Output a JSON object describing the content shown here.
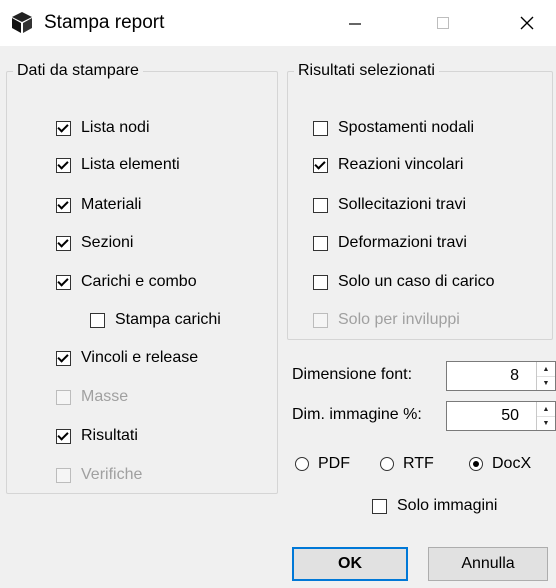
{
  "window": {
    "title": "Stampa report",
    "controls": {
      "minimize": "—",
      "maximize": "☐",
      "close": "✕"
    }
  },
  "print_data_group": {
    "legend": "Dati da stampare",
    "items": [
      {
        "label": "Lista nodi",
        "checked": true,
        "enabled": true
      },
      {
        "label": "Lista elementi",
        "checked": true,
        "enabled": true
      },
      {
        "label": "Materiali",
        "checked": true,
        "enabled": true
      },
      {
        "label": "Sezioni",
        "checked": true,
        "enabled": true
      },
      {
        "label": "Carichi e combo",
        "checked": true,
        "enabled": true
      },
      {
        "label": "Stampa carichi",
        "checked": false,
        "enabled": true
      },
      {
        "label": "Vincoli e release",
        "checked": true,
        "enabled": true
      },
      {
        "label": "Masse",
        "checked": false,
        "enabled": false
      },
      {
        "label": "Risultati",
        "checked": true,
        "enabled": true
      },
      {
        "label": "Verifiche",
        "checked": false,
        "enabled": false
      }
    ]
  },
  "results_group": {
    "legend": "Risultati selezionati",
    "items": [
      {
        "label": "Spostamenti nodali",
        "checked": false,
        "enabled": true
      },
      {
        "label": "Reazioni vincolari",
        "checked": true,
        "enabled": true
      },
      {
        "label": "Sollecitazioni travi",
        "checked": false,
        "enabled": true
      },
      {
        "label": "Deformazioni travi",
        "checked": false,
        "enabled": true
      },
      {
        "label": "Solo un caso di carico",
        "checked": false,
        "enabled": true
      },
      {
        "label": "Solo per inviluppi",
        "checked": false,
        "enabled": false
      }
    ]
  },
  "font_size": {
    "label": "Dimensione font:",
    "value": "8"
  },
  "image_size": {
    "label": "Dim. immagine %:",
    "value": "50"
  },
  "format": {
    "options": [
      "PDF",
      "RTF",
      "DocX"
    ],
    "selected": "DocX"
  },
  "images_only": {
    "label": "Solo immagini",
    "checked": false
  },
  "buttons": {
    "ok": "OK",
    "cancel": "Annulla"
  },
  "icons": {
    "app": "cube-icon",
    "spin_up": "arrow-up-icon",
    "spin_down": "arrow-down-icon"
  }
}
